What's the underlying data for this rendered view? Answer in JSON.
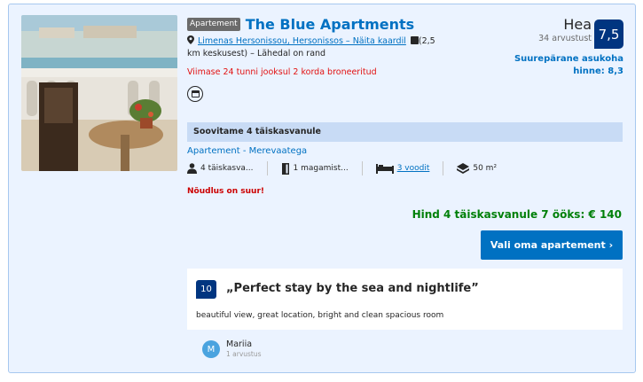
{
  "property": {
    "type_badge": "Apartement",
    "name": "The Blue Apartments",
    "location_link": "Limenas Hersonissou, Hersonissos – Näita kaardil",
    "distance": "(2,5 km keskusest)",
    "distance_extra": "– Lähedal on rand",
    "booked_notice": "Viimase 24 tunni jooksul 2 korda broneeritud",
    "facility_icon": "kitchen-icon"
  },
  "rating": {
    "word": "Hea",
    "score": "7,5",
    "reviews_count": "34 arvustust",
    "location_score": "Suurepärane asukoha hinne: 8,3"
  },
  "unit": {
    "recommend": "Soovitame 4 täiskasvanule",
    "name": "Apartement - Merevaatega",
    "guests": "4 täiskasva...",
    "bedrooms": "1 magamist...",
    "beds": "3 voodit",
    "size": "50 m²",
    "demand": "Nõudlus on suur!",
    "price": "Hind 4 täiskasvanule 7 ööks: € 140",
    "cta": "Vali oma apartement ›"
  },
  "review": {
    "score": "10",
    "title": "„Perfect stay by the sea and nightlife”",
    "text": "beautiful view, great location, bright and clean spacious room",
    "author_initial": "M",
    "author_name": "Mariia",
    "author_reviews": "1 arvustus"
  },
  "colors": {
    "brand_blue": "#0071c2",
    "navy": "#003580",
    "green": "#008009",
    "red": "#e21111"
  }
}
